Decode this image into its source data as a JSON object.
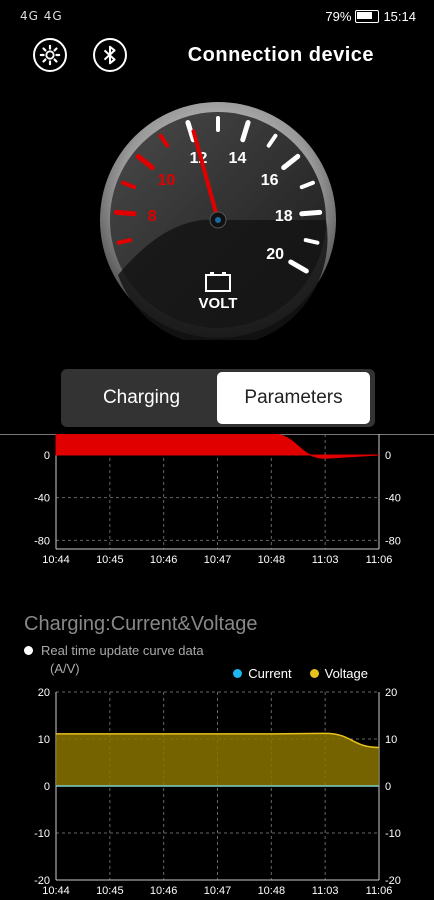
{
  "status_bar": {
    "left_text": "4G 4G",
    "battery": "79%",
    "time": "15:14"
  },
  "header": {
    "title": "Connection device",
    "settings_icon": "gear-icon",
    "bluetooth_icon": "bluetooth-icon"
  },
  "gauge": {
    "ticks": [
      "8",
      "10",
      "12",
      "14",
      "16",
      "18",
      "20"
    ],
    "red_ticks": [
      "8",
      "10"
    ],
    "unit": "VOLT",
    "value": 12.1,
    "min": 6,
    "max": 20
  },
  "tabs": {
    "charging": "Charging",
    "parameters": "Parameters",
    "selected": "Parameters"
  },
  "section": {
    "title": "Charging:Current&Voltage",
    "subtitle": "Real time update curve data",
    "unit": "(A/V)"
  },
  "legend": {
    "current": "Current",
    "voltage": "Voltage",
    "current_color": "#1fb7f2",
    "voltage_color": "#e6c21a"
  },
  "chart_data": [
    {
      "type": "area",
      "x": [
        "10:44",
        "10:45",
        "10:46",
        "10:47",
        "10:48",
        "11:03",
        "11:06"
      ],
      "series": [
        {
          "values": [
            20,
            20,
            20,
            20,
            20,
            -3,
            0
          ],
          "color": "#e00000"
        }
      ],
      "ylim": [
        -90,
        0
      ],
      "yticks_left": [
        "0",
        "-40",
        "-80"
      ],
      "yticks_right": [
        "0",
        "-40",
        "-80"
      ]
    },
    {
      "type": "area",
      "x": [
        "10:44",
        "10:45",
        "10:46",
        "10:47",
        "10:48",
        "11:03",
        "11:06"
      ],
      "series": [
        {
          "name": "Current",
          "values": [
            0,
            0,
            0,
            0,
            0,
            0,
            0
          ],
          "color": "#1fb7f2"
        },
        {
          "name": "Voltage",
          "values": [
            11.1,
            11.1,
            11.1,
            11.1,
            11.1,
            11.2,
            8.2
          ],
          "color": "#e6c21a"
        }
      ],
      "ylim": [
        -20,
        20
      ],
      "yticks_left": [
        "20",
        "10",
        "0",
        "-10",
        "-20"
      ],
      "yticks_right": [
        "20",
        "10",
        "0",
        "-10",
        "-20"
      ],
      "ylabel": "(A/V)"
    }
  ]
}
